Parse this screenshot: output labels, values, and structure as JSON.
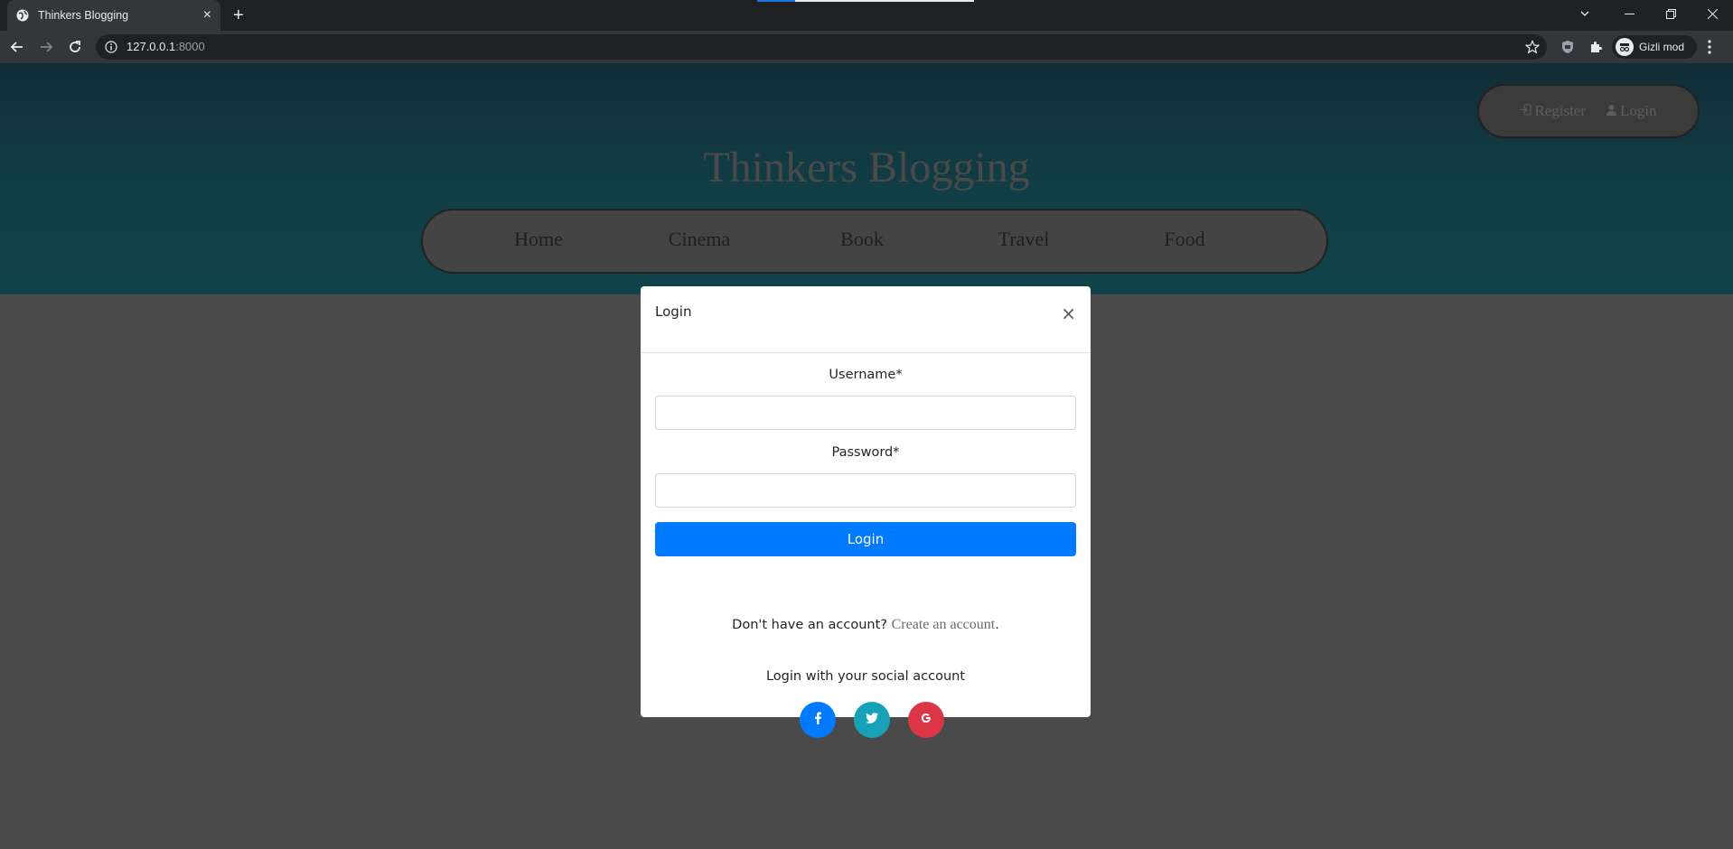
{
  "browser": {
    "tab_title": "Thinkers Blogging",
    "url_host": "127.0.0.1",
    "url_port": ":8000",
    "profile_label": "Gizli mod"
  },
  "page": {
    "site_title": "Thinkers Blogging",
    "auth": {
      "register_label": "Register",
      "login_label": "Login"
    },
    "nav_items": [
      "Home",
      "Cinema",
      "Book",
      "Travel",
      "Food"
    ]
  },
  "modal": {
    "title": "Login",
    "close_symbol": "×",
    "username_label": "Username*",
    "password_label": "Password*",
    "submit_label": "Login",
    "signup_prompt": "Don't have an account?",
    "signup_link": "Create an account",
    "signup_suffix": ".",
    "social_text": "Login with your social account",
    "social_buttons": [
      {
        "network": "facebook",
        "glyph": "f",
        "color": "#007bff"
      },
      {
        "network": "twitter",
        "glyph": "t",
        "color": "#17a2b8"
      },
      {
        "network": "google",
        "glyph": "G",
        "color": "#dc3545"
      }
    ]
  },
  "colors": {
    "primary": "#007bff",
    "hero_bg": "#123e46",
    "overlay_bg": "#4a4a4a"
  }
}
